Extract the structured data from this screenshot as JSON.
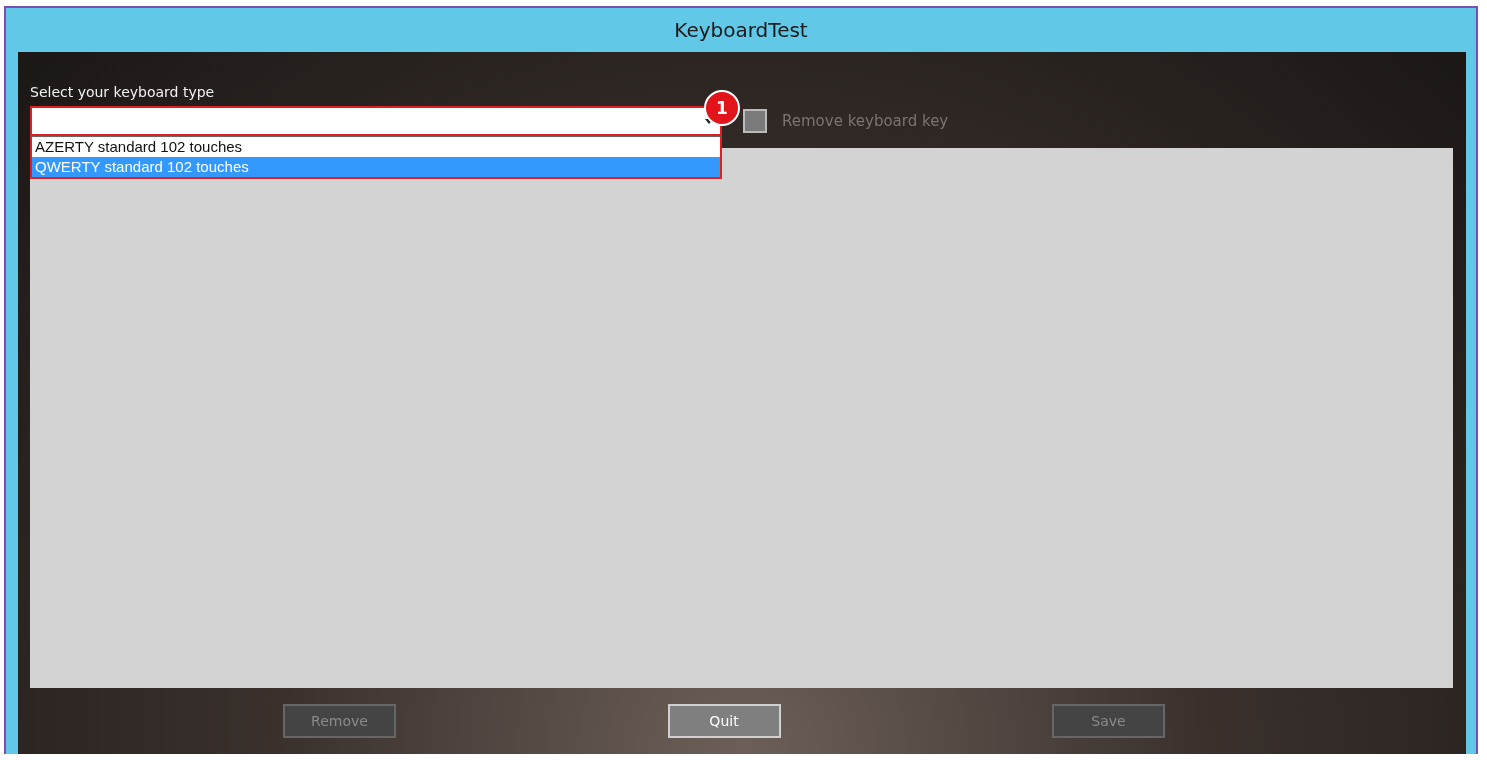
{
  "window": {
    "title": "KeyboardTest"
  },
  "keyboard_type": {
    "label": "Select your keyboard type",
    "expanded": true,
    "options": [
      {
        "label": "AZERTY standard 102 touches",
        "selected": false
      },
      {
        "label": "QWERTY standard 102 touches",
        "selected": true
      }
    ]
  },
  "callout": "1",
  "remove_key": {
    "label": "Remove keyboard key",
    "checked": false,
    "disabled": true
  },
  "buttons": [
    {
      "label": "Remove",
      "disabled": true
    },
    {
      "label": "Quit",
      "disabled": false
    },
    {
      "label": "Save",
      "disabled": true
    }
  ]
}
